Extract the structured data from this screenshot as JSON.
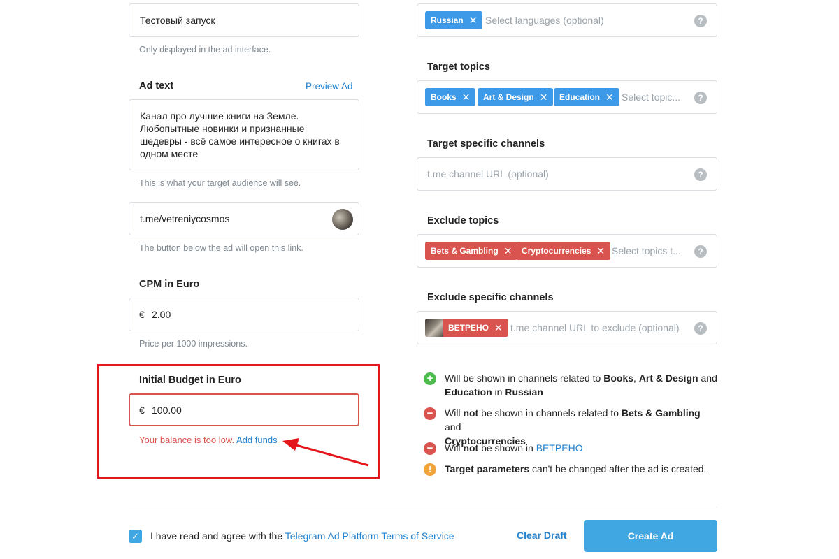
{
  "left": {
    "title_field": {
      "value": "Тестовый запуск",
      "hint": "Only displayed in the ad interface."
    },
    "ad_text": {
      "label": "Ad text",
      "preview_link": "Preview Ad",
      "lines": [
        "Канал про лучшие книги на Земле.",
        "Любопытные новинки и признанные",
        "шедевры - всё самое интересное о книгах в",
        "одном месте"
      ],
      "hint": "This is what your target audience will see."
    },
    "url_field": {
      "value": "t.me/vetreniycosmos",
      "hint": "The button below the ad will open this link."
    },
    "cpm": {
      "label": "CPM in Euro",
      "currency": "€",
      "value": "2.00",
      "hint": "Price per 1000 impressions."
    },
    "budget": {
      "label": "Initial Budget in Euro",
      "currency": "€",
      "value": "100.00",
      "error": "Your balance is too low.",
      "add_funds": "Add funds"
    }
  },
  "right": {
    "languages": {
      "chips": [
        "Russian"
      ],
      "placeholder": "Select languages (optional)"
    },
    "target_topics": {
      "label": "Target topics",
      "chips": [
        "Books",
        "Art & Design",
        "Education"
      ],
      "placeholder": "Select topic..."
    },
    "target_channels": {
      "label": "Target specific channels",
      "placeholder": "t.me channel URL (optional)"
    },
    "exclude_topics": {
      "label": "Exclude topics",
      "chips": [
        "Bets & Gambling",
        "Cryptocurrencies"
      ],
      "placeholder": "Select topics t..."
    },
    "exclude_channels": {
      "label": "Exclude specific channels",
      "chip": "ВЕТРЕНО",
      "placeholder": "t.me channel URL to exclude (optional)"
    },
    "summary": {
      "line1": {
        "pre": "Will be shown in channels related to ",
        "b1": "Books",
        "s1": ", ",
        "b2": "Art & Design",
        "s2": " and",
        "b3": "Education",
        "s3": " in ",
        "b4": "Russian"
      },
      "line2": {
        "pre": "Will ",
        "not": "not",
        "mid": " be shown in channels related to ",
        "b1": "Bets & Gambling",
        "s1": " and",
        "b2": "Cryptocurrencies"
      },
      "line3": {
        "pre": "Will ",
        "not": "not",
        "mid": " be shown in ",
        "link": "ВЕТРЕНО"
      },
      "line4": {
        "bold": "Target parameters",
        "rest": " can't be changed after the ad is created."
      }
    }
  },
  "footer": {
    "agree_text": "I have read and agree with the ",
    "terms_link": "Telegram Ad Platform Terms of Service",
    "clear_draft": "Clear Draft",
    "create_ad": "Create Ad"
  },
  "icons": {
    "question": "?",
    "close": "✕",
    "plus": "+",
    "minus": "−",
    "warning": "!",
    "check": "✓"
  },
  "colors": {
    "accent": "#2481cc",
    "primary_button": "#40a7e3",
    "chip_blue": "#3d9ae8",
    "chip_red": "#d9534f",
    "error_text": "#d9534f",
    "annotation_red": "#e5161b",
    "success": "#4cba4c",
    "danger": "#d9534f",
    "warning": "#f0a33a"
  }
}
